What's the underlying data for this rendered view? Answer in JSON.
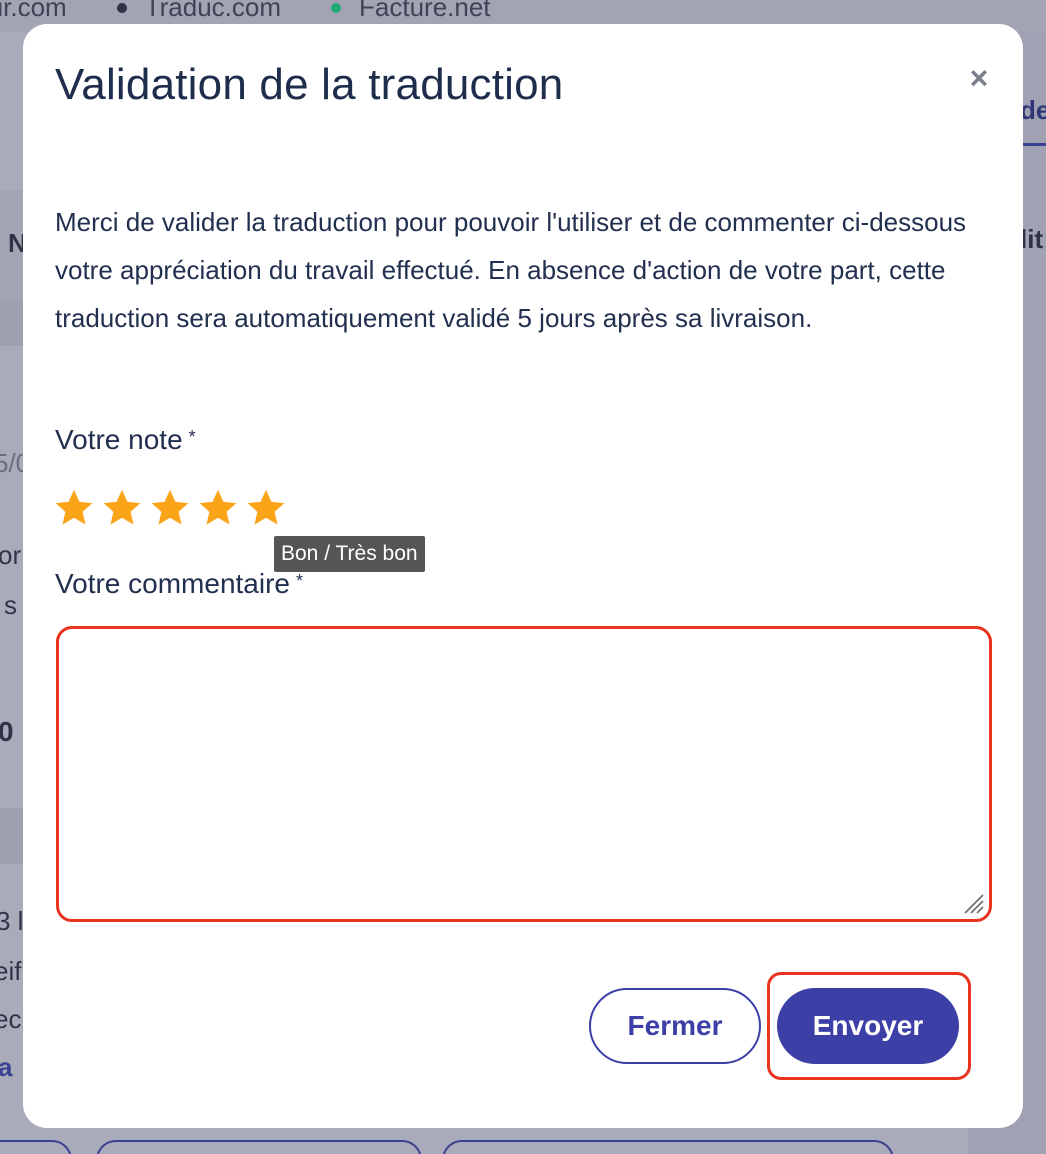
{
  "background": {
    "sites": [
      {
        "label": "cteur.com",
        "dot_color": ""
      },
      {
        "label": "Traduc.com",
        "dot_color": "#2c3344"
      },
      {
        "label": "Facture.net",
        "dot_color": "#1faa7a"
      }
    ],
    "right_tab_fragment": "de",
    "right_text_fragment": "lit",
    "left_fragments": [
      "N",
      "5/0",
      "or",
      "s",
      "0",
      "3 l",
      "eif",
      "ec",
      "a"
    ]
  },
  "modal": {
    "title": "Validation de la traduction",
    "close_symbol": "×",
    "description": "Merci de valider la traduction pour pouvoir l'utiliser et de commenter ci-dessous votre appréciation du travail effectué. En absence d'action de votre part, cette traduction sera automatiquement validé 5 jours après sa livraison.",
    "rating": {
      "label": "Votre note",
      "required_mark": "*",
      "value": 5,
      "max": 5,
      "star_icon": "star-icon",
      "star_color": "#fba418",
      "tooltip": "Bon / Très bon"
    },
    "comment": {
      "label": "Votre commentaire",
      "required_mark": "*",
      "value": "",
      "placeholder": "",
      "error_border_color": "#e8341e"
    },
    "buttons": {
      "close_label": "Fermer",
      "send_label": "Envoyer",
      "accent_color": "#3b3fa6"
    }
  }
}
